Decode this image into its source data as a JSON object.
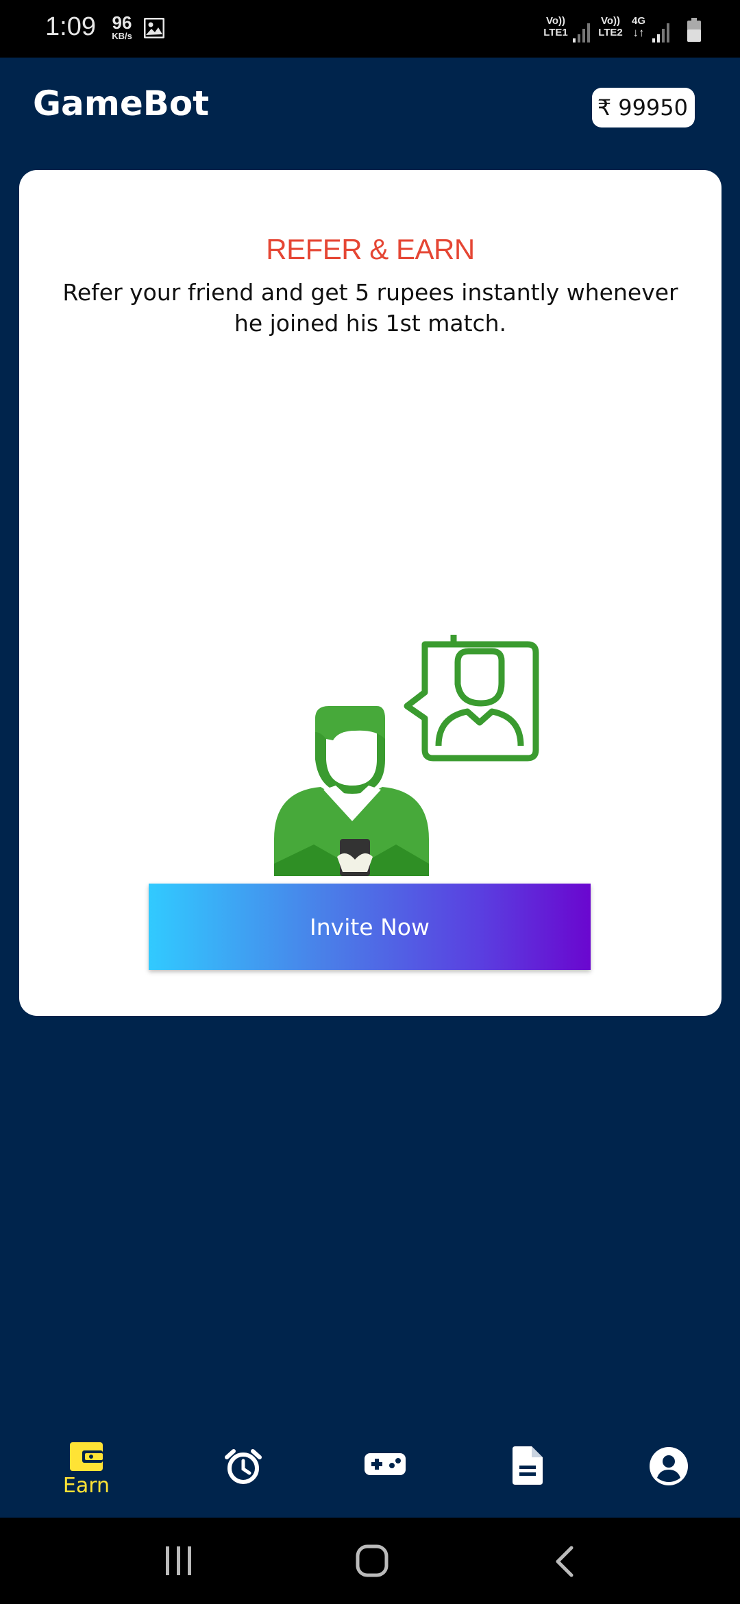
{
  "status_bar": {
    "time": "1:09",
    "speed_value": "96",
    "speed_unit": "KB/s",
    "sim1": {
      "top": "Vo))",
      "bottom": "LTE1"
    },
    "sim2": {
      "top": "Vo))",
      "bottom": "LTE2"
    },
    "network_type": "4G"
  },
  "header": {
    "title": "GameBot",
    "currency_symbol": "₹",
    "balance": "99950"
  },
  "card": {
    "title": "REFER & EARN",
    "description": "Refer your friend and get 5 rupees instantly whenever he joined his 1st match.",
    "button_label": "Invite Now"
  },
  "bottom_nav": {
    "items": [
      {
        "label": "Earn",
        "icon": "wallet-icon",
        "active": true
      },
      {
        "label": "",
        "icon": "alarm-clock-icon",
        "active": false
      },
      {
        "label": "",
        "icon": "gamepad-icon",
        "active": false
      },
      {
        "label": "",
        "icon": "document-icon",
        "active": false
      },
      {
        "label": "",
        "icon": "account-icon",
        "active": false
      }
    ]
  },
  "colors": {
    "background": "#00244c",
    "title_red": "#e54634",
    "active_nav": "#ffe335",
    "illustration_green": "#3a9b2f",
    "gradient_start": "#31caff",
    "gradient_end": "#6a07cf"
  }
}
